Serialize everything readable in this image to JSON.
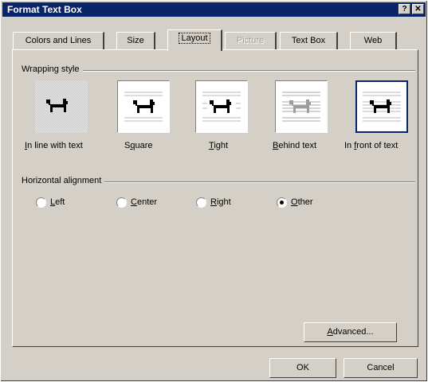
{
  "window": {
    "title": "Format Text Box",
    "help_button": "?",
    "close_button": "✕"
  },
  "tabs": [
    {
      "label": "Colors and Lines",
      "state": "normal"
    },
    {
      "label": "Size",
      "state": "normal"
    },
    {
      "label": "Layout",
      "state": "active"
    },
    {
      "label": "Picture",
      "state": "disabled"
    },
    {
      "label": "Text Box",
      "state": "normal"
    },
    {
      "label": "Web",
      "state": "normal"
    }
  ],
  "wrapping": {
    "group_label": "Wrapping style",
    "options": [
      {
        "label": "In line with text",
        "mnemonic": "I",
        "icon": "dog-icon"
      },
      {
        "label": "Square",
        "mnemonic": "q",
        "icon": "dog-icon"
      },
      {
        "label": "Tight",
        "mnemonic": "T",
        "icon": "dog-icon"
      },
      {
        "label": "Behind text",
        "mnemonic": "B",
        "icon": "dog-icon"
      },
      {
        "label": "In front of text",
        "mnemonic": "f",
        "icon": "dog-icon",
        "selected": true
      }
    ]
  },
  "alignment": {
    "group_label": "Horizontal alignment",
    "options": [
      {
        "label": "Left",
        "mnemonic": "L",
        "checked": false
      },
      {
        "label": "Center",
        "mnemonic": "C",
        "checked": false
      },
      {
        "label": "Right",
        "mnemonic": "R",
        "checked": false
      },
      {
        "label": "Other",
        "mnemonic": "O",
        "checked": true
      }
    ]
  },
  "buttons": {
    "advanced": "Advanced...",
    "ok": "OK",
    "cancel": "Cancel"
  },
  "colors": {
    "titlebar": "#0a246a",
    "face": "#d4d0c8",
    "selection": "#0a246a"
  }
}
